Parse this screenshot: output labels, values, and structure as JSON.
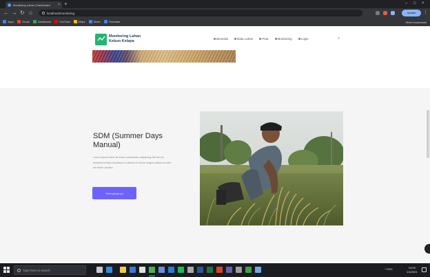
{
  "browser": {
    "tab_title": "Monitoring Lahan | Dashboard",
    "new_tab": "+",
    "url": "localhost/monitoring",
    "profile_label": "Update",
    "window_controls": {
      "minimize": "–",
      "maximize": "□",
      "close": "×"
    }
  },
  "bookmarks": [
    {
      "label": "Apps",
      "color": "#4285f4"
    },
    {
      "label": "Gmail",
      "color": "#ea4335"
    },
    {
      "label": "Dashboard",
      "color": "#34a853"
    },
    {
      "label": "YouTube",
      "color": "#ff0000"
    },
    {
      "label": "Maps",
      "color": "#fbbc05"
    },
    {
      "label": "News",
      "color": "#4285f4"
    },
    {
      "label": "Translate",
      "color": "#4285f4"
    }
  ],
  "bookmarks_other": "Other bookmarks",
  "site": {
    "logo_line1": "Monitoring Lahan",
    "logo_line2": "Kebun Kelapa",
    "nav": [
      {
        "label": "Beranda"
      },
      {
        "label": "Data Lahan"
      },
      {
        "label": "Peta"
      },
      {
        "label": "Monitoring"
      },
      {
        "label": "Login"
      }
    ]
  },
  "hero": {
    "title": "SDM (Summer Days Manual)",
    "description": "Lorem ipsum dolor sit amet consectetur adipiscing elit sed do eiusmod tempor incididunt ut labore et dolore magna aliqua ut enim ad minim veniam",
    "button_label": "Selengkapnya"
  },
  "taskbar": {
    "search_placeholder": "Type here to search",
    "apps": [
      {
        "name": "task-view",
        "color": "#c9c9c9"
      },
      {
        "name": "edge",
        "color": "#2f8fe0"
      },
      {
        "name": "file-explorer",
        "color": "#f2c94c"
      },
      {
        "name": "store",
        "color": "#3a7bd5"
      },
      {
        "name": "mail",
        "color": "#e0e0e0"
      },
      {
        "name": "chrome",
        "color": "#4caf50"
      },
      {
        "name": "photos",
        "color": "#6a8fd8"
      },
      {
        "name": "vscode",
        "color": "#2a7bd6"
      },
      {
        "name": "spotify",
        "color": "#1db954"
      },
      {
        "name": "terminal",
        "color": "#aaaaaa"
      },
      {
        "name": "word",
        "color": "#2b5797"
      },
      {
        "name": "excel",
        "color": "#217346"
      },
      {
        "name": "powerpoint",
        "color": "#d24726"
      },
      {
        "name": "teams",
        "color": "#6264a7"
      },
      {
        "name": "settings",
        "color": "#9e9e9e"
      },
      {
        "name": "maps",
        "color": "#43a047"
      },
      {
        "name": "notepad",
        "color": "#6ea8e0"
      }
    ],
    "tray_text": "^ ENG",
    "time": "14:00",
    "date": "1/1/2021"
  }
}
